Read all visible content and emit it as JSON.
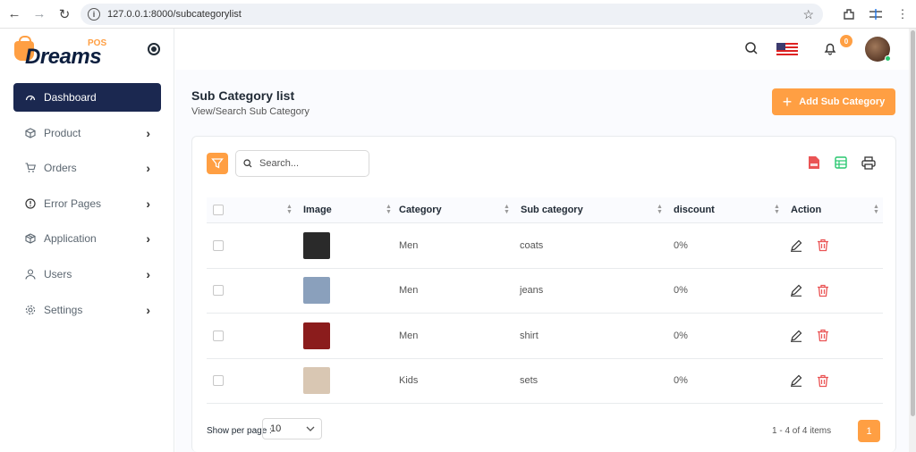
{
  "browser": {
    "url": "127.0.0.1:8000/subcategorylist"
  },
  "brand": {
    "logo_text": "Dreams",
    "logo_sub": "POS",
    "accent_color": "#ff9f43",
    "nav_dark": "#1b2850"
  },
  "sidebar": {
    "items": [
      {
        "label": "Dashboard",
        "icon": "dashboard-icon",
        "active": true
      },
      {
        "label": "Product",
        "icon": "box-icon"
      },
      {
        "label": "Orders",
        "icon": "cart-icon"
      },
      {
        "label": "Error Pages",
        "icon": "alert-circle-icon"
      },
      {
        "label": "Application",
        "icon": "package-icon"
      },
      {
        "label": "Users",
        "icon": "user-icon"
      },
      {
        "label": "Settings",
        "icon": "gear-icon"
      }
    ]
  },
  "header": {
    "notification_count": "0"
  },
  "page": {
    "title": "Sub Category list",
    "subtitle": "View/Search Sub Category",
    "add_button": "Add Sub Category"
  },
  "search": {
    "placeholder": "Search..."
  },
  "table": {
    "headers": [
      "Image",
      "Category",
      "Sub category",
      "discount",
      "Action"
    ],
    "rows": [
      {
        "category": "Men",
        "sub_category": "coats",
        "discount": "0%",
        "thumb_color": "#2a2a2a"
      },
      {
        "category": "Men",
        "sub_category": "jeans",
        "discount": "0%",
        "thumb_color": "#8aa0bc"
      },
      {
        "category": "Men",
        "sub_category": "shirt",
        "discount": "0%",
        "thumb_color": "#8b1c1c"
      },
      {
        "category": "Kids",
        "sub_category": "sets",
        "discount": "0%",
        "thumb_color": "#d9c7b3"
      }
    ]
  },
  "footer": {
    "show_per_page": "Show per page :",
    "per_page_value": "10",
    "items_info": "1 - 4 of 4 items",
    "current_page": "1"
  }
}
